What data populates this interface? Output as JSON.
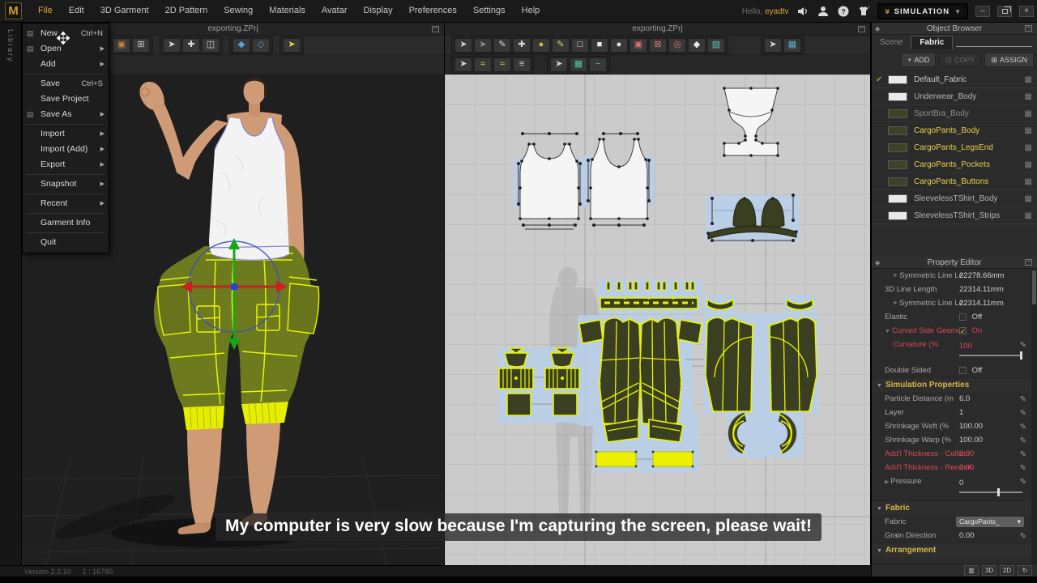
{
  "app": {
    "logo": "M"
  },
  "menubar": {
    "items": [
      "File",
      "Edit",
      "3D Garment",
      "2D Pattern",
      "Sewing",
      "Materials",
      "Avatar",
      "Display",
      "Preferences",
      "Settings",
      "Help"
    ],
    "active_item": "File",
    "greeting_prefix": "Hello,",
    "username": "eyadtv",
    "simulation_label": "SIMULATION"
  },
  "file_menu": {
    "items": [
      {
        "label": "New",
        "shortcut": "Ctrl+N",
        "submenu": false,
        "icon": true
      },
      {
        "label": "Open",
        "shortcut": "",
        "submenu": true,
        "icon": true
      },
      {
        "label": "Add",
        "shortcut": "",
        "submenu": true,
        "icon": false
      },
      {
        "label": "Save",
        "shortcut": "Ctrl+S",
        "submenu": false,
        "icon": false
      },
      {
        "label": "Save Project",
        "shortcut": "",
        "submenu": false,
        "icon": false
      },
      {
        "label": "Save As",
        "shortcut": "",
        "submenu": true,
        "icon": true
      },
      {
        "label": "Import",
        "shortcut": "",
        "submenu": true,
        "icon": false
      },
      {
        "label": "Import (Add)",
        "shortcut": "",
        "submenu": true,
        "icon": false
      },
      {
        "label": "Export",
        "shortcut": "",
        "submenu": true,
        "icon": false
      },
      {
        "label": "Snapshot",
        "shortcut": "",
        "submenu": true,
        "icon": false
      },
      {
        "label": "Recent",
        "shortcut": "",
        "submenu": true,
        "icon": false
      },
      {
        "label": "Garment Info",
        "shortcut": "",
        "submenu": false,
        "icon": false
      },
      {
        "label": "Quit",
        "shortcut": "",
        "submenu": false,
        "icon": false
      }
    ],
    "separators_after": [
      2,
      5,
      8,
      9,
      10,
      11
    ]
  },
  "left_strip": {
    "label": "Library"
  },
  "viewport3d": {
    "title": "exporting.ZPrj"
  },
  "viewport2d": {
    "title": "exporting.ZPrj"
  },
  "toolbars": {
    "viewport3d_row1": [
      [
        {
          "name": "snapshot-tool-icon",
          "glyph": "▣",
          "color": "#c8803c"
        },
        {
          "name": "open-capture-icon",
          "glyph": "⊞",
          "color": "#cfcfcf"
        }
      ],
      [
        {
          "name": "select-pen-icon",
          "glyph": "➤",
          "color": "#d8d8d8"
        },
        {
          "name": "pin-tool-icon",
          "glyph": "✚",
          "color": "#d8d8d8"
        },
        {
          "name": "avatar-tape-icon",
          "glyph": "◫",
          "color": "#d8d8d8"
        }
      ],
      [
        {
          "name": "show-garment-icon",
          "glyph": "◆",
          "color": "#5aa2dc"
        },
        {
          "name": "show-avatar-icon",
          "glyph": "◇",
          "color": "#5aa2dc"
        }
      ],
      [
        {
          "name": "simulate-icon",
          "glyph": "➤",
          "color": "#e6d44a"
        }
      ]
    ],
    "viewport3d_row2": [
      [
        {
          "name": "gizmo-select-icon",
          "glyph": "➤",
          "color": "#d8d8d8"
        },
        {
          "name": "window-select-icon",
          "glyph": "◪",
          "color": "#62c8c8"
        }
      ]
    ],
    "viewport2d_row1": [
      [
        {
          "name": "transform-pattern-icon",
          "glyph": "➤",
          "color": "#d8d8d8"
        },
        {
          "name": "transform-template-icon",
          "glyph": "➤",
          "color": "#8f8f8f"
        },
        {
          "name": "edit-pattern-icon",
          "glyph": "✎",
          "color": "#d8d8d8"
        },
        {
          "name": "edit-curve-point-icon",
          "glyph": "✚",
          "color": "#d8d8d8"
        },
        {
          "name": "add-point-icon",
          "glyph": "●",
          "color": "#d8b850"
        },
        {
          "name": "edit-curvature-icon",
          "glyph": "✎",
          "color": "#d8d850"
        },
        {
          "name": "polygon-tool-icon",
          "glyph": "□",
          "color": "#e8e8e8"
        },
        {
          "name": "rectangle-tool-icon",
          "glyph": "■",
          "color": "#e8e8e8"
        },
        {
          "name": "circle-tool-icon",
          "glyph": "●",
          "color": "#e8e8e8"
        },
        {
          "name": "dart-tool-icon",
          "glyph": "▣",
          "color": "#d87272"
        },
        {
          "name": "dart-x-icon",
          "glyph": "⊠",
          "color": "#d87272"
        },
        {
          "name": "round-dart-icon",
          "glyph": "◎",
          "color": "#d87272"
        },
        {
          "name": "diamond-dart-icon",
          "glyph": "◆",
          "color": "#e8e8e8"
        },
        {
          "name": "pleats-tool-icon",
          "glyph": "▧",
          "color": "#58c8b8"
        }
      ],
      [
        {
          "name": "texture-select-icon",
          "glyph": "➤",
          "color": "#d8d8d8"
        },
        {
          "name": "texture-edit-icon",
          "glyph": "▦",
          "color": "#58aed8"
        }
      ]
    ],
    "viewport2d_row2": [
      [
        {
          "name": "segment-sew-icon",
          "glyph": "➤",
          "color": "#d8d8d8"
        },
        {
          "name": "free-sew-icon",
          "glyph": "≈",
          "color": "#d8d850"
        },
        {
          "name": "mn-free-sew-icon",
          "glyph": "≈",
          "color": "#d8d850"
        },
        {
          "name": "mn-segment-sew-icon",
          "glyph": "≡",
          "color": "#d8d8d8"
        }
      ],
      [
        {
          "name": "grade-select-icon",
          "glyph": "➤",
          "color": "#d8d8d8"
        },
        {
          "name": "grade-grid-icon",
          "glyph": "▦",
          "color": "#50c890"
        },
        {
          "name": "grade-line-icon",
          "glyph": "−",
          "color": "#50c890"
        }
      ]
    ]
  },
  "object_browser": {
    "title": "Object Browser",
    "tabs": [
      {
        "label": "Scene",
        "active": false
      },
      {
        "label": "Fabric",
        "active": true
      }
    ],
    "buttons": [
      {
        "label": "ADD",
        "icon": "+",
        "enabled": true
      },
      {
        "label": "COPY",
        "icon": "⊡",
        "enabled": false
      },
      {
        "label": "ASSIGN",
        "icon": "⊞",
        "enabled": true
      }
    ],
    "fabrics": [
      {
        "name": "Default_Fabric",
        "swatch": "#e9e9e9",
        "checked": true,
        "name_color": "#cccccc"
      },
      {
        "name": "Underwear_Body",
        "swatch": "#e9e9e9",
        "checked": false,
        "name_color": "#b5b5b5"
      },
      {
        "name": "SportBra_Body",
        "swatch": "#3f4226",
        "checked": false,
        "name_color": "#8f8f8f"
      },
      {
        "name": "CargoPants_Body",
        "swatch": "#3f4226",
        "checked": false,
        "name_color": "#e6cf4e"
      },
      {
        "name": "CargoPants_LegsEnd",
        "swatch": "#3f4226",
        "checked": false,
        "name_color": "#e6cf4e"
      },
      {
        "name": "CargoPants_Pockets",
        "swatch": "#3f4226",
        "checked": false,
        "name_color": "#e6cf4e"
      },
      {
        "name": "CargoPants_Buttons",
        "swatch": "#3f4226",
        "checked": false,
        "name_color": "#e6cf4e"
      },
      {
        "name": "SleevelessTShirt_Body",
        "swatch": "#e9e9e9",
        "checked": false,
        "name_color": "#b5b5b5"
      },
      {
        "name": "SleevelessTShirt_Strips",
        "swatch": "#e9e9e9",
        "checked": false,
        "name_color": "#b5b5b5"
      }
    ]
  },
  "property_editor": {
    "title": "Property Editor",
    "rows": [
      {
        "type": "value",
        "indent": 2,
        "label": "+ Symmetric Line Le",
        "value": "22278.66mm",
        "editable": false,
        "alert": false
      },
      {
        "type": "value",
        "indent": 1,
        "label": "3D Line Length",
        "value": "22314.11mm",
        "editable": false,
        "alert": false
      },
      {
        "type": "value",
        "indent": 2,
        "label": "+ Symmetric Line Le",
        "value": "22314.11mm",
        "editable": false,
        "alert": false
      },
      {
        "type": "checkbox",
        "indent": 1,
        "label": "Elastic",
        "value": "Off",
        "checked": false,
        "alert": false
      },
      {
        "type": "checkbox",
        "indent": 1,
        "label": "Curved Side Geome",
        "value": "On",
        "checked": true,
        "alert": true,
        "prefix": "▼"
      },
      {
        "type": "slider",
        "indent": 2,
        "label": "Curvature (%",
        "value": "100",
        "pos": 96,
        "editable": true,
        "alert": true
      },
      {
        "type": "checkbox",
        "indent": 1,
        "label": "Double Sided",
        "value": "Off",
        "checked": false,
        "alert": false
      },
      {
        "type": "section",
        "label": "Simulation Properties"
      },
      {
        "type": "value",
        "indent": 1,
        "label": "Particle Distance (m",
        "value": "6.0",
        "editable": true,
        "alert": false
      },
      {
        "type": "value",
        "indent": 1,
        "label": "Layer",
        "value": "1",
        "editable": true,
        "alert": false
      },
      {
        "type": "value",
        "indent": 1,
        "label": "Shrinkage Weft (%",
        "value": "100.00",
        "editable": true,
        "alert": false
      },
      {
        "type": "value",
        "indent": 1,
        "label": "Shrinkage Warp (%",
        "value": "100.00",
        "editable": true,
        "alert": false
      },
      {
        "type": "value",
        "indent": 1,
        "label": "Add'l Thickness - Collisio",
        "value": "2.00",
        "editable": true,
        "alert": true
      },
      {
        "type": "value",
        "indent": 1,
        "label": "Add'l Thickness - Renderi",
        "value": "2.00",
        "editable": true,
        "alert": true
      },
      {
        "type": "slider",
        "indent": 1,
        "label": "Pressure",
        "value": "0",
        "pos": 60,
        "editable": true,
        "alert": false,
        "prefix": "▶"
      },
      {
        "type": "section",
        "label": "Fabric"
      },
      {
        "type": "dropdown",
        "indent": 1,
        "label": "Fabric",
        "value": "CargoPants_"
      },
      {
        "type": "value",
        "indent": 1,
        "label": "Grain Direction",
        "value": "0.00",
        "editable": true,
        "alert": false
      },
      {
        "type": "section",
        "label": "Arrangement"
      }
    ]
  },
  "panel_footer": {
    "buttons": [
      {
        "name": "split-view-icon",
        "glyph": "▥"
      },
      {
        "name": "view-3d-button",
        "glyph": "3D"
      },
      {
        "name": "view-2d-button",
        "glyph": "2D"
      },
      {
        "name": "sync-view-icon",
        "glyph": "↻"
      }
    ]
  },
  "statusbar": {
    "left": "Version 2.2.10",
    "right": "1 : 16780"
  },
  "subtitle": {
    "text": "My computer is very slow because I'm capturing the screen, please wait!"
  },
  "colors": {
    "accent_gold": "#d8a73a",
    "alert_red": "#d84a5a",
    "selection_blue": "#b9cfe9",
    "pattern_yellow": "#e8f400",
    "fabric_olive": "#6d7a1e"
  }
}
